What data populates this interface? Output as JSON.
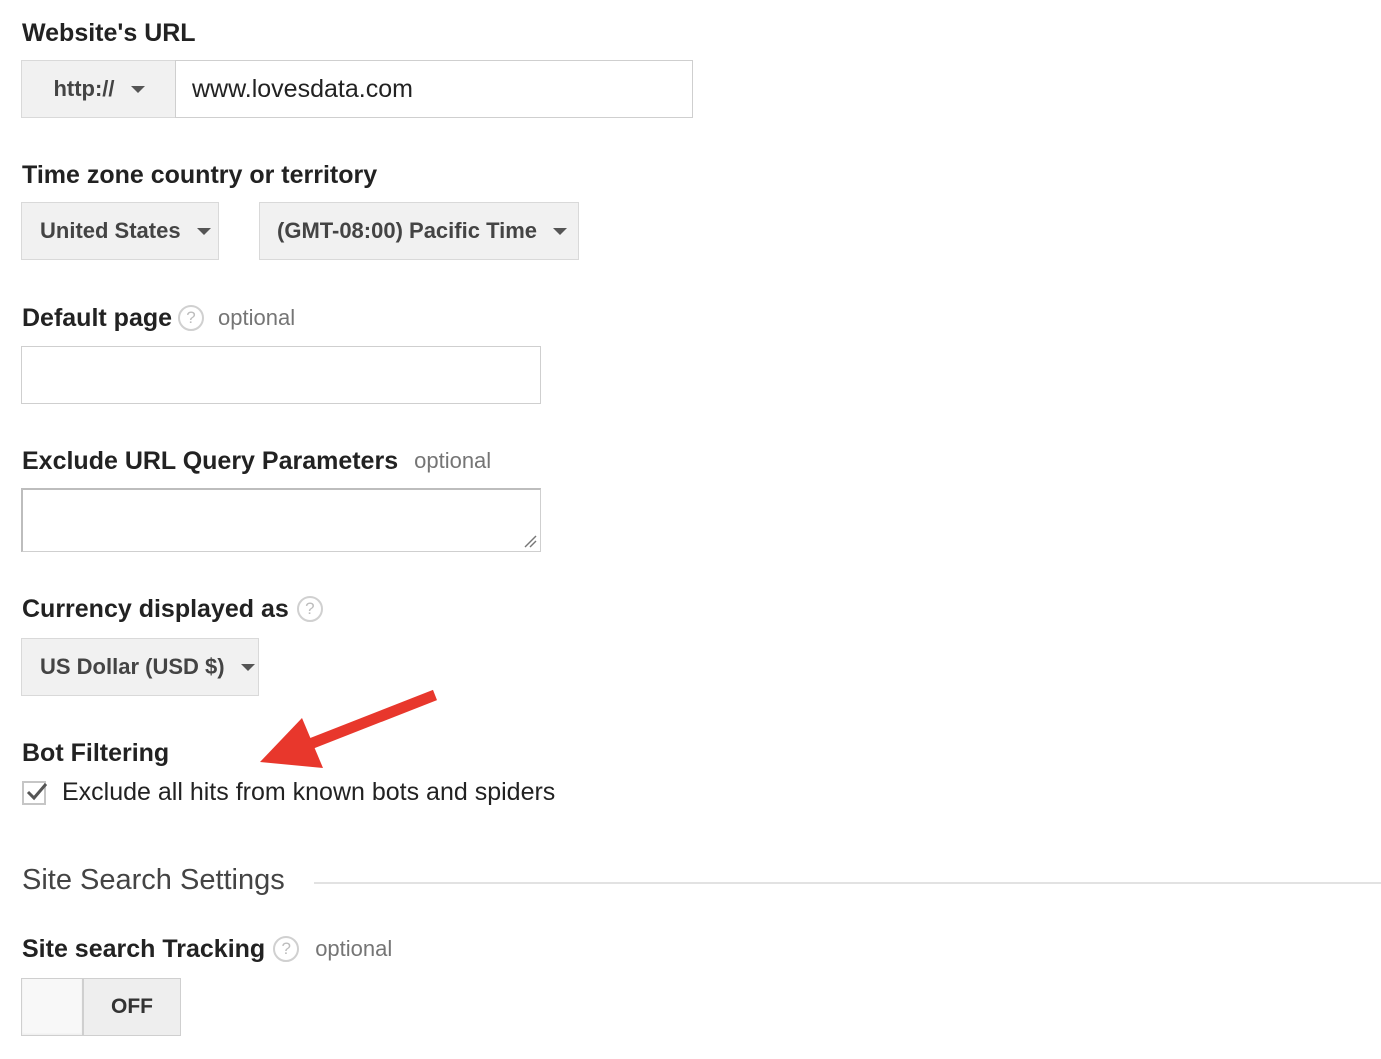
{
  "website_url": {
    "label": "Website's URL",
    "protocol": "http://",
    "value": "www.lovesdata.com"
  },
  "time_zone": {
    "label": "Time zone country or territory",
    "country": "United States",
    "zone": "(GMT-08:00) Pacific Time"
  },
  "default_page": {
    "label": "Default page",
    "optional": "optional",
    "help_glyph": "?",
    "value": ""
  },
  "exclude_params": {
    "label": "Exclude URL Query Parameters",
    "optional": "optional",
    "value": ""
  },
  "currency": {
    "label": "Currency displayed as",
    "help_glyph": "?",
    "value": "US Dollar (USD $)"
  },
  "bot_filtering": {
    "label": "Bot Filtering",
    "checkbox_label": "Exclude all hits from known bots and spiders",
    "checked": true
  },
  "site_search": {
    "section_title": "Site Search Settings",
    "tracking_label": "Site search Tracking",
    "help_glyph": "?",
    "optional": "optional",
    "toggle_state": "OFF"
  },
  "colors": {
    "annotation_arrow": "#e8372c",
    "button_bg": "#f1f1f1",
    "border": "#d9d9d9"
  },
  "icons": {
    "help": "question-circle-icon",
    "select": "caret-down-icon",
    "checkbox": "checkmark-icon",
    "annotation": "red-arrow-icon",
    "resize": "resize-grip-icon"
  }
}
